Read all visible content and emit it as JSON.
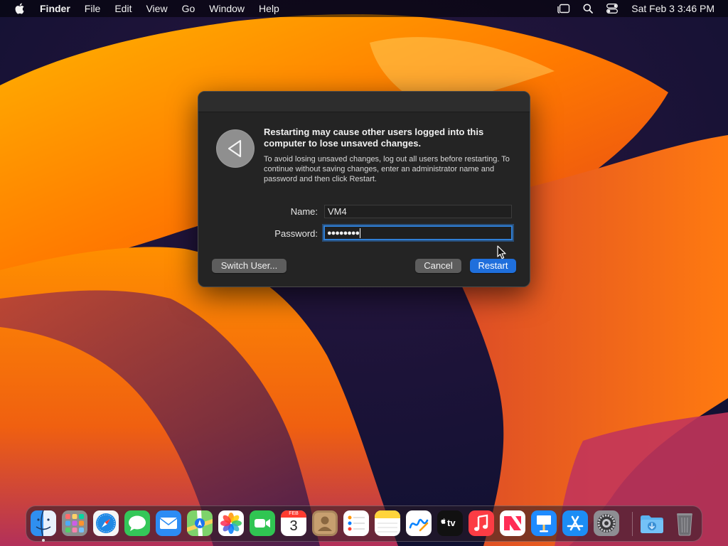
{
  "menubar": {
    "app_name": "Finder",
    "menus": [
      "File",
      "Edit",
      "View",
      "Go",
      "Window",
      "Help"
    ],
    "clock": "Sat Feb 3  3:46 PM",
    "status_icons": [
      "stage-manager-icon",
      "spotlight-search-icon",
      "control-center-icon"
    ]
  },
  "dialog": {
    "headline": "Restarting may cause other users logged into this computer to lose unsaved changes.",
    "body": "To avoid losing unsaved changes, log out all users before restarting. To continue without saving changes, enter an administrator name and password and then click Restart.",
    "name_label": "Name:",
    "name_value": "VM4",
    "password_label": "Password:",
    "password_mask": "●●●●●●●●",
    "switch_user_label": "Switch User...",
    "cancel_label": "Cancel",
    "restart_label": "Restart"
  },
  "dock": {
    "calendar_month": "FEB",
    "calendar_day": "3",
    "tv_label": "tv",
    "apps": [
      "Finder",
      "Launchpad",
      "Safari",
      "Messages",
      "Mail",
      "Maps",
      "Photos",
      "FaceTime",
      "Calendar",
      "Contacts",
      "Reminders",
      "Notes",
      "Freeform",
      "TV",
      "Music",
      "News",
      "Keynote",
      "App Store",
      "System Settings",
      "Downloads",
      "Trash"
    ]
  },
  "colors": {
    "accent": "#1f6fdc",
    "dialog_bg": "#242424",
    "wallpaper_orange": "#ff8a00",
    "wallpaper_dark": "#1a0f3a"
  }
}
